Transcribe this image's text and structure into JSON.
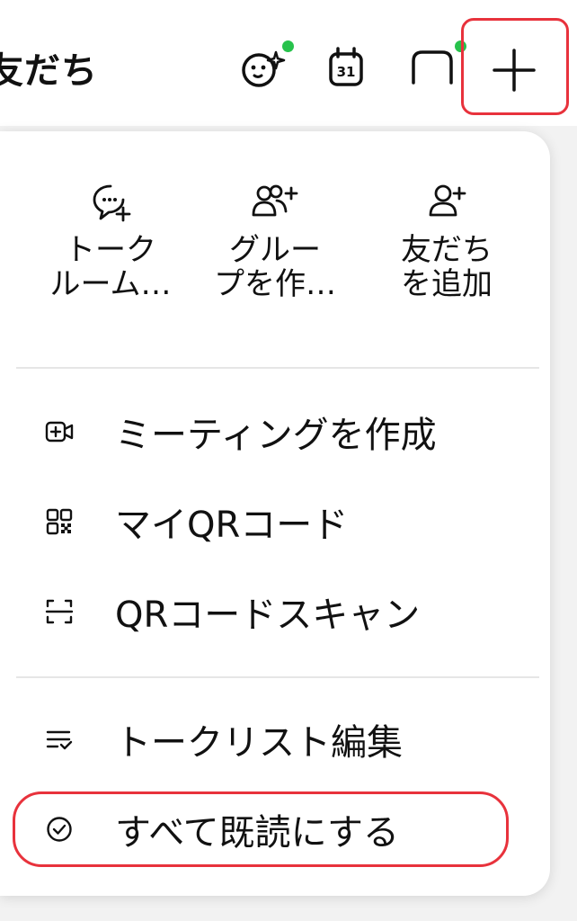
{
  "header": {
    "title": "友だち",
    "icons": [
      "face-sparkle-icon",
      "calendar-icon",
      "chat-bubble-icon",
      "plus-icon"
    ],
    "calendar_day": "31",
    "badge_color": "#27c24c"
  },
  "menu": {
    "quick_actions": [
      {
        "label": "トーク\nルーム…",
        "icon": "chat-plus-icon"
      },
      {
        "label": "グルー\nプを作…",
        "icon": "group-add-icon"
      },
      {
        "label": "友だち\nを追加",
        "icon": "person-add-icon"
      }
    ],
    "items": [
      {
        "label": "ミーティングを作成",
        "icon": "video-plus-icon"
      },
      {
        "label": "マイQRコード",
        "icon": "qr-code-icon"
      },
      {
        "label": "QRコードスキャン",
        "icon": "qr-scan-icon"
      },
      {
        "label": "トークリスト編集",
        "icon": "list-edit-icon"
      },
      {
        "label": "すべて既読にする",
        "icon": "check-circle-icon"
      }
    ]
  },
  "highlight_color": "#e8323c"
}
